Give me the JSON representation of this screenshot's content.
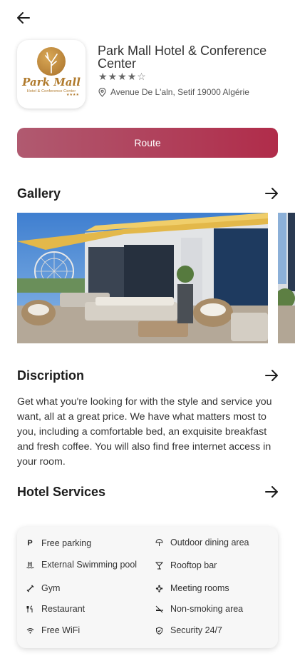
{
  "hotel": {
    "logo_text": "Park Mall",
    "logo_subtext": "Hotel & Conference Center",
    "logo_stars": "★★★★",
    "name": "Park Mall Hotel & Conference Center",
    "rating": 4,
    "rating_max": 5,
    "address": "Avenue De L'aln, Setif 19000 Algérie"
  },
  "route_button": {
    "label": "Route"
  },
  "gallery": {
    "title": "Gallery"
  },
  "description": {
    "title": "Discription",
    "text": "Get what you're looking for with the style and service you want, all at a great price. We have what matters most to you, including a comfortable bed, an exquisite breakfast and fresh coffee. You will also find free internet access in your room."
  },
  "services": {
    "title": "Hotel Services",
    "left": [
      {
        "icon": "parking-icon",
        "label": "Free parking"
      },
      {
        "icon": "swimming-pool-icon",
        "label": "External Swimming pool"
      },
      {
        "icon": "gym-icon",
        "label": "Gym"
      },
      {
        "icon": "restaurant-icon",
        "label": "Restaurant"
      },
      {
        "icon": "wifi-icon",
        "label": "Free WiFi"
      }
    ],
    "right": [
      {
        "icon": "umbrella-icon",
        "label": "Outdoor dining area"
      },
      {
        "icon": "cocktail-icon",
        "label": "Rooftop bar"
      },
      {
        "icon": "meeting-icon",
        "label": "Meeting rooms"
      },
      {
        "icon": "no-smoking-icon",
        "label": "Non-smoking area"
      },
      {
        "icon": "shield-icon",
        "label": "Security 24/7"
      }
    ]
  },
  "colors": {
    "accent_start": "#b05a70",
    "accent_end": "#b02c4a",
    "logo_gold": "#b07a2c"
  }
}
